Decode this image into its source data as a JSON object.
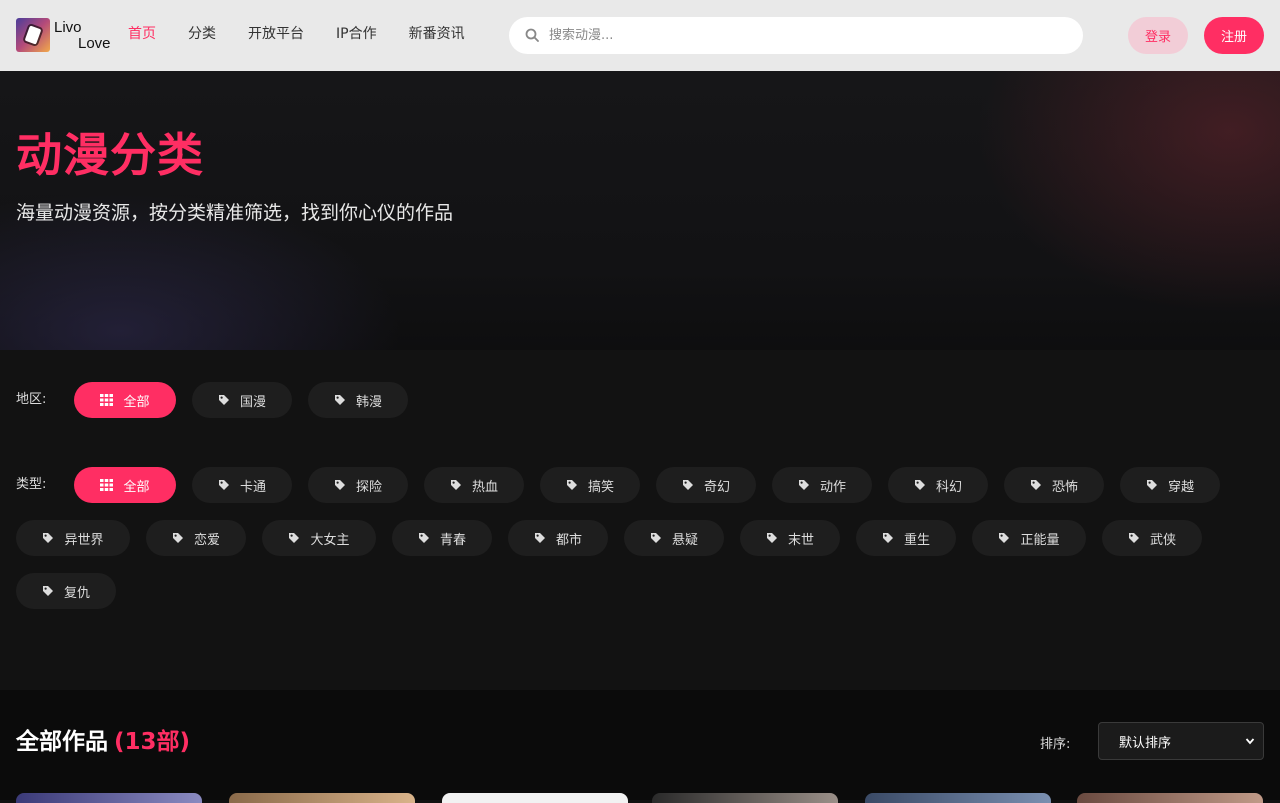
{
  "header": {
    "logo_line1": "Livo",
    "logo_line2": "Love",
    "nav": [
      {
        "label": "首页",
        "active": true
      },
      {
        "label": "分类",
        "active": false
      },
      {
        "label": "开放平台",
        "active": false
      },
      {
        "label": "IP合作",
        "active": false
      },
      {
        "label": "新番资讯",
        "active": false
      }
    ],
    "search_placeholder": "搜索动漫...",
    "login_label": "登录",
    "register_label": "注册"
  },
  "hero": {
    "title": "动漫分类",
    "subtitle": "海量动漫资源，按分类精准筛选，找到你心仪的作品"
  },
  "filters": {
    "region": {
      "label": "地区:",
      "options": [
        "全部",
        "国漫",
        "韩漫"
      ],
      "selected": "全部"
    },
    "type": {
      "label": "类型:",
      "options": [
        "全部",
        "卡通",
        "探险",
        "热血",
        "搞笑",
        "奇幻",
        "动作",
        "科幻",
        "恐怖",
        "穿越",
        "异世界",
        "恋爱",
        "大女主",
        "青春",
        "都市",
        "悬疑",
        "末世",
        "重生",
        "正能量",
        "武侠",
        "复仇"
      ],
      "selected": "全部"
    }
  },
  "works": {
    "title": "全部作品",
    "count": "(13部)",
    "sort_label": "排序:",
    "sort_value": "默认排序"
  },
  "colors": {
    "accent": "#ff2e63",
    "header_bg": "#e9e9e9",
    "chip_bg": "#1e1e1e",
    "page_bg": "#111111"
  }
}
